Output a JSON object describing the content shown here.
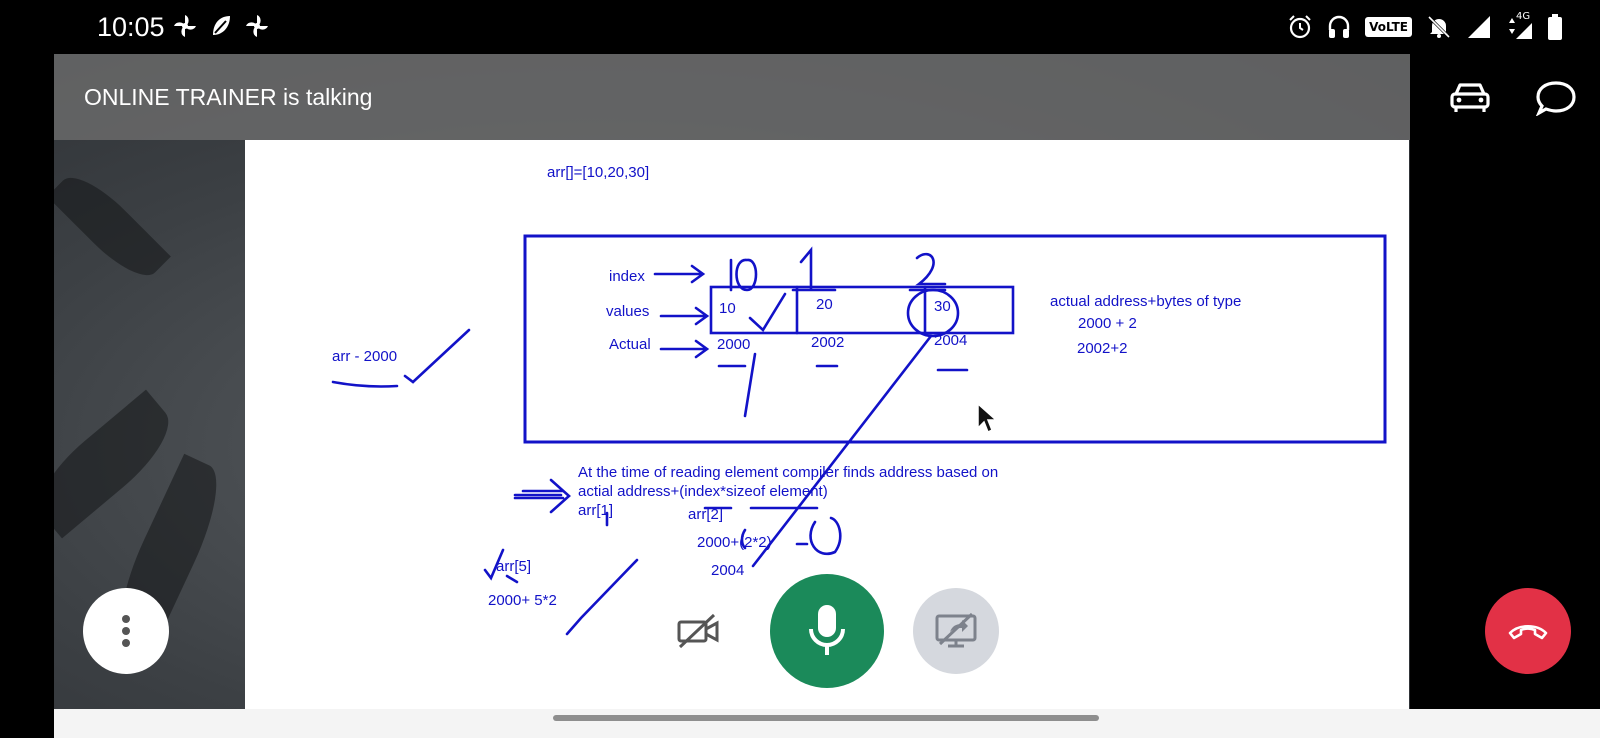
{
  "status_bar": {
    "time": "10:05",
    "left_icons": [
      "pinwheel-icon",
      "leaf-app-icon",
      "pinwheel-icon"
    ],
    "right_icons": [
      "alarm-icon",
      "headphones-icon",
      "volte-badge",
      "bell-off-icon",
      "signal-icon",
      "data-arrows-icon",
      "battery-icon"
    ],
    "volte_label": "VoLTE",
    "network_label": "4G"
  },
  "call": {
    "speaker_text": "ONLINE TRAINER is talking",
    "header_icons": [
      "car-icon",
      "chat-bubble-icon"
    ]
  },
  "whiteboard": {
    "heading": "arr[]=[10,20,30]",
    "row_labels": [
      "index",
      "values",
      "Actual"
    ],
    "indexes": [
      "0",
      "1",
      "2"
    ],
    "values": [
      "10",
      "20",
      "30"
    ],
    "addresses": [
      "2000",
      "2002",
      "2004"
    ],
    "side_note": "arr - 2000",
    "formula_title": "actual address+bytes of type",
    "formula_lines": [
      "2000 + 2",
      "2002+2"
    ],
    "explanation_line1": "At the time of reading element compiler finds address based on",
    "explanation_line2": "actial address+(index*sizeof element)",
    "example1": "arr[1]",
    "example2": "arr[2]",
    "example2_calc": "2000+(2*2)",
    "example2_result": "2004",
    "example3": "arr[5]",
    "example3_calc": "2000+ 5*2"
  },
  "controls": {
    "more_icon": "more-vert-icon",
    "camera_icon": "camera-off-icon",
    "mic_icon": "mic-icon",
    "share_icon": "screen-share-off-icon",
    "end_icon": "end-call-icon"
  },
  "colors": {
    "ink": "#1212c8",
    "mic_active": "#1b8a5a",
    "end_call": "#e23146",
    "header_overlay": "#6e6e6e"
  }
}
